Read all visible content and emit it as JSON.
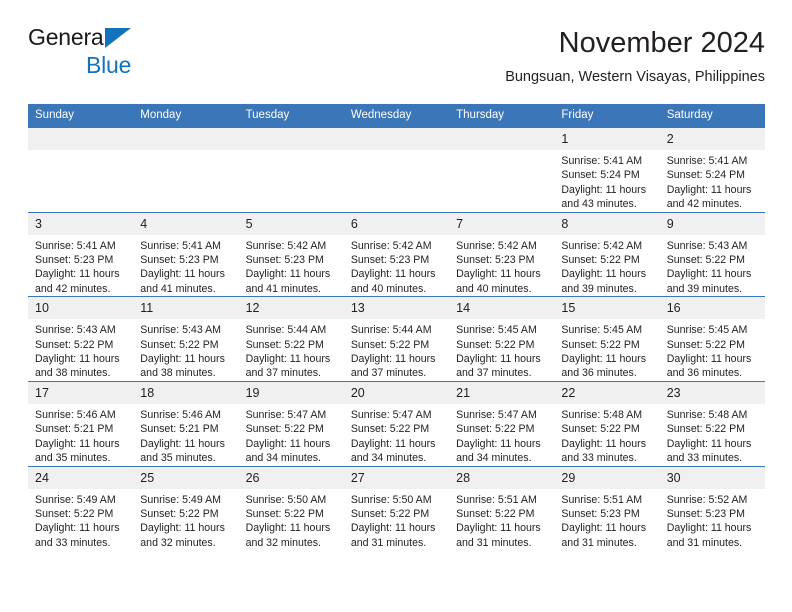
{
  "brand": {
    "line1": "General",
    "line2": "Blue",
    "accent": "#1373ba"
  },
  "header": {
    "title": "November 2024",
    "location": "Bungsuan, Western Visayas, Philippines",
    "header_bg": "#3b76b8",
    "daynum_bg": "#f0f0f0"
  },
  "weekday_headers": [
    "Sunday",
    "Monday",
    "Tuesday",
    "Wednesday",
    "Thursday",
    "Friday",
    "Saturday"
  ],
  "weeks": [
    [
      {
        "day": "",
        "lines": []
      },
      {
        "day": "",
        "lines": []
      },
      {
        "day": "",
        "lines": []
      },
      {
        "day": "",
        "lines": []
      },
      {
        "day": "",
        "lines": []
      },
      {
        "day": "1",
        "lines": [
          "Sunrise: 5:41 AM",
          "Sunset: 5:24 PM",
          "Daylight: 11 hours",
          "and 43 minutes."
        ]
      },
      {
        "day": "2",
        "lines": [
          "Sunrise: 5:41 AM",
          "Sunset: 5:24 PM",
          "Daylight: 11 hours",
          "and 42 minutes."
        ]
      }
    ],
    [
      {
        "day": "3",
        "lines": [
          "Sunrise: 5:41 AM",
          "Sunset: 5:23 PM",
          "Daylight: 11 hours",
          "and 42 minutes."
        ]
      },
      {
        "day": "4",
        "lines": [
          "Sunrise: 5:41 AM",
          "Sunset: 5:23 PM",
          "Daylight: 11 hours",
          "and 41 minutes."
        ]
      },
      {
        "day": "5",
        "lines": [
          "Sunrise: 5:42 AM",
          "Sunset: 5:23 PM",
          "Daylight: 11 hours",
          "and 41 minutes."
        ]
      },
      {
        "day": "6",
        "lines": [
          "Sunrise: 5:42 AM",
          "Sunset: 5:23 PM",
          "Daylight: 11 hours",
          "and 40 minutes."
        ]
      },
      {
        "day": "7",
        "lines": [
          "Sunrise: 5:42 AM",
          "Sunset: 5:23 PM",
          "Daylight: 11 hours",
          "and 40 minutes."
        ]
      },
      {
        "day": "8",
        "lines": [
          "Sunrise: 5:42 AM",
          "Sunset: 5:22 PM",
          "Daylight: 11 hours",
          "and 39 minutes."
        ]
      },
      {
        "day": "9",
        "lines": [
          "Sunrise: 5:43 AM",
          "Sunset: 5:22 PM",
          "Daylight: 11 hours",
          "and 39 minutes."
        ]
      }
    ],
    [
      {
        "day": "10",
        "lines": [
          "Sunrise: 5:43 AM",
          "Sunset: 5:22 PM",
          "Daylight: 11 hours",
          "and 38 minutes."
        ]
      },
      {
        "day": "11",
        "lines": [
          "Sunrise: 5:43 AM",
          "Sunset: 5:22 PM",
          "Daylight: 11 hours",
          "and 38 minutes."
        ]
      },
      {
        "day": "12",
        "lines": [
          "Sunrise: 5:44 AM",
          "Sunset: 5:22 PM",
          "Daylight: 11 hours",
          "and 37 minutes."
        ]
      },
      {
        "day": "13",
        "lines": [
          "Sunrise: 5:44 AM",
          "Sunset: 5:22 PM",
          "Daylight: 11 hours",
          "and 37 minutes."
        ]
      },
      {
        "day": "14",
        "lines": [
          "Sunrise: 5:45 AM",
          "Sunset: 5:22 PM",
          "Daylight: 11 hours",
          "and 37 minutes."
        ]
      },
      {
        "day": "15",
        "lines": [
          "Sunrise: 5:45 AM",
          "Sunset: 5:22 PM",
          "Daylight: 11 hours",
          "and 36 minutes."
        ]
      },
      {
        "day": "16",
        "lines": [
          "Sunrise: 5:45 AM",
          "Sunset: 5:22 PM",
          "Daylight: 11 hours",
          "and 36 minutes."
        ]
      }
    ],
    [
      {
        "day": "17",
        "lines": [
          "Sunrise: 5:46 AM",
          "Sunset: 5:21 PM",
          "Daylight: 11 hours",
          "and 35 minutes."
        ]
      },
      {
        "day": "18",
        "lines": [
          "Sunrise: 5:46 AM",
          "Sunset: 5:21 PM",
          "Daylight: 11 hours",
          "and 35 minutes."
        ]
      },
      {
        "day": "19",
        "lines": [
          "Sunrise: 5:47 AM",
          "Sunset: 5:22 PM",
          "Daylight: 11 hours",
          "and 34 minutes."
        ]
      },
      {
        "day": "20",
        "lines": [
          "Sunrise: 5:47 AM",
          "Sunset: 5:22 PM",
          "Daylight: 11 hours",
          "and 34 minutes."
        ]
      },
      {
        "day": "21",
        "lines": [
          "Sunrise: 5:47 AM",
          "Sunset: 5:22 PM",
          "Daylight: 11 hours",
          "and 34 minutes."
        ]
      },
      {
        "day": "22",
        "lines": [
          "Sunrise: 5:48 AM",
          "Sunset: 5:22 PM",
          "Daylight: 11 hours",
          "and 33 minutes."
        ]
      },
      {
        "day": "23",
        "lines": [
          "Sunrise: 5:48 AM",
          "Sunset: 5:22 PM",
          "Daylight: 11 hours",
          "and 33 minutes."
        ]
      }
    ],
    [
      {
        "day": "24",
        "lines": [
          "Sunrise: 5:49 AM",
          "Sunset: 5:22 PM",
          "Daylight: 11 hours",
          "and 33 minutes."
        ]
      },
      {
        "day": "25",
        "lines": [
          "Sunrise: 5:49 AM",
          "Sunset: 5:22 PM",
          "Daylight: 11 hours",
          "and 32 minutes."
        ]
      },
      {
        "day": "26",
        "lines": [
          "Sunrise: 5:50 AM",
          "Sunset: 5:22 PM",
          "Daylight: 11 hours",
          "and 32 minutes."
        ]
      },
      {
        "day": "27",
        "lines": [
          "Sunrise: 5:50 AM",
          "Sunset: 5:22 PM",
          "Daylight: 11 hours",
          "and 31 minutes."
        ]
      },
      {
        "day": "28",
        "lines": [
          "Sunrise: 5:51 AM",
          "Sunset: 5:22 PM",
          "Daylight: 11 hours",
          "and 31 minutes."
        ]
      },
      {
        "day": "29",
        "lines": [
          "Sunrise: 5:51 AM",
          "Sunset: 5:23 PM",
          "Daylight: 11 hours",
          "and 31 minutes."
        ]
      },
      {
        "day": "30",
        "lines": [
          "Sunrise: 5:52 AM",
          "Sunset: 5:23 PM",
          "Daylight: 11 hours",
          "and 31 minutes."
        ]
      }
    ]
  ]
}
